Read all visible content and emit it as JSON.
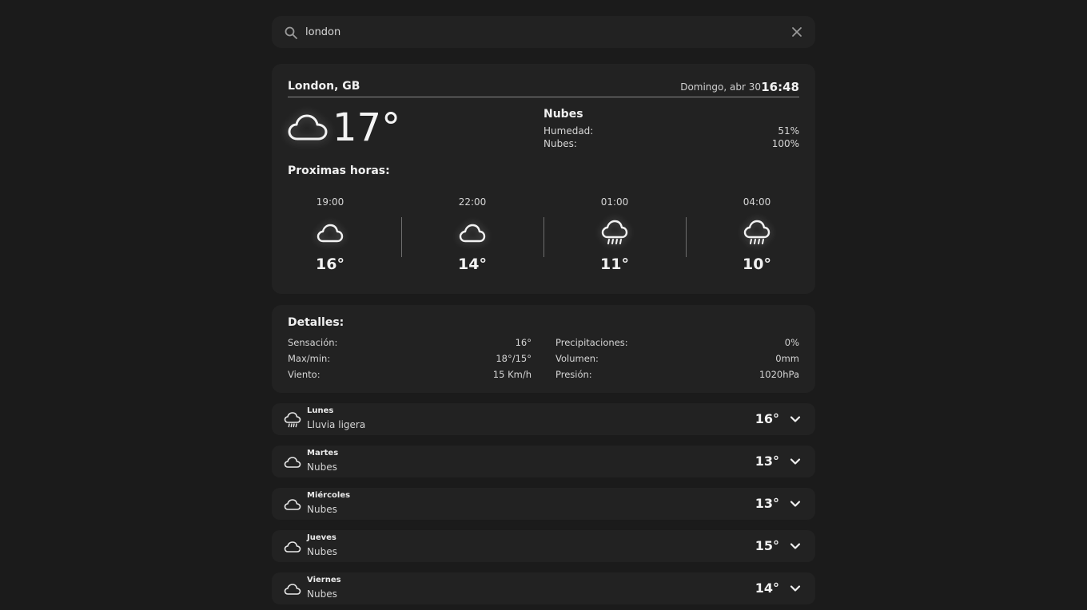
{
  "search": {
    "value": "london",
    "placeholder": ""
  },
  "location": {
    "city": "London, GB",
    "date": "Domingo, abr 30",
    "time": "16:48"
  },
  "current": {
    "icon": "cloud-icon",
    "temp": "17°",
    "condition": "Nubes",
    "humidity_label": "Humedad:",
    "humidity_value": "51%",
    "clouds_label": "Nubes:",
    "clouds_value": "100%"
  },
  "hourly": {
    "title": "Proximas horas:",
    "items": [
      {
        "time": "19:00",
        "icon": "cloud-icon",
        "temp": "16°"
      },
      {
        "time": "22:00",
        "icon": "cloud-icon",
        "temp": "14°"
      },
      {
        "time": "01:00",
        "icon": "rain-icon",
        "temp": "11°"
      },
      {
        "time": "04:00",
        "icon": "rain-icon",
        "temp": "10°"
      }
    ]
  },
  "details": {
    "title": "Detalles:",
    "left": [
      {
        "label": "Sensación:",
        "value": "16°"
      },
      {
        "label": "Max/min:",
        "value": "18°/15°"
      },
      {
        "label": "Viento:",
        "value": "15 Km/h"
      }
    ],
    "right": [
      {
        "label": "Precipitaciones:",
        "value": "0%"
      },
      {
        "label": "Volumen:",
        "value": "0mm"
      },
      {
        "label": "Presión:",
        "value": "1020hPa"
      }
    ]
  },
  "forecast": [
    {
      "day": "Lunes",
      "desc": "Lluvia ligera",
      "icon": "rain-icon",
      "temp": "16°"
    },
    {
      "day": "Martes",
      "desc": "Nubes",
      "icon": "cloud-icon",
      "temp": "13°"
    },
    {
      "day": "Miércoles",
      "desc": "Nubes",
      "icon": "cloud-icon",
      "temp": "13°"
    },
    {
      "day": "Jueves",
      "desc": "Nubes",
      "icon": "cloud-icon",
      "temp": "15°"
    },
    {
      "day": "Viernes",
      "desc": "Nubes",
      "icon": "cloud-icon",
      "temp": "14°"
    }
  ],
  "colors": {
    "background": "#1b1b1b",
    "card": "#222222",
    "text": "#e6e6e6"
  }
}
